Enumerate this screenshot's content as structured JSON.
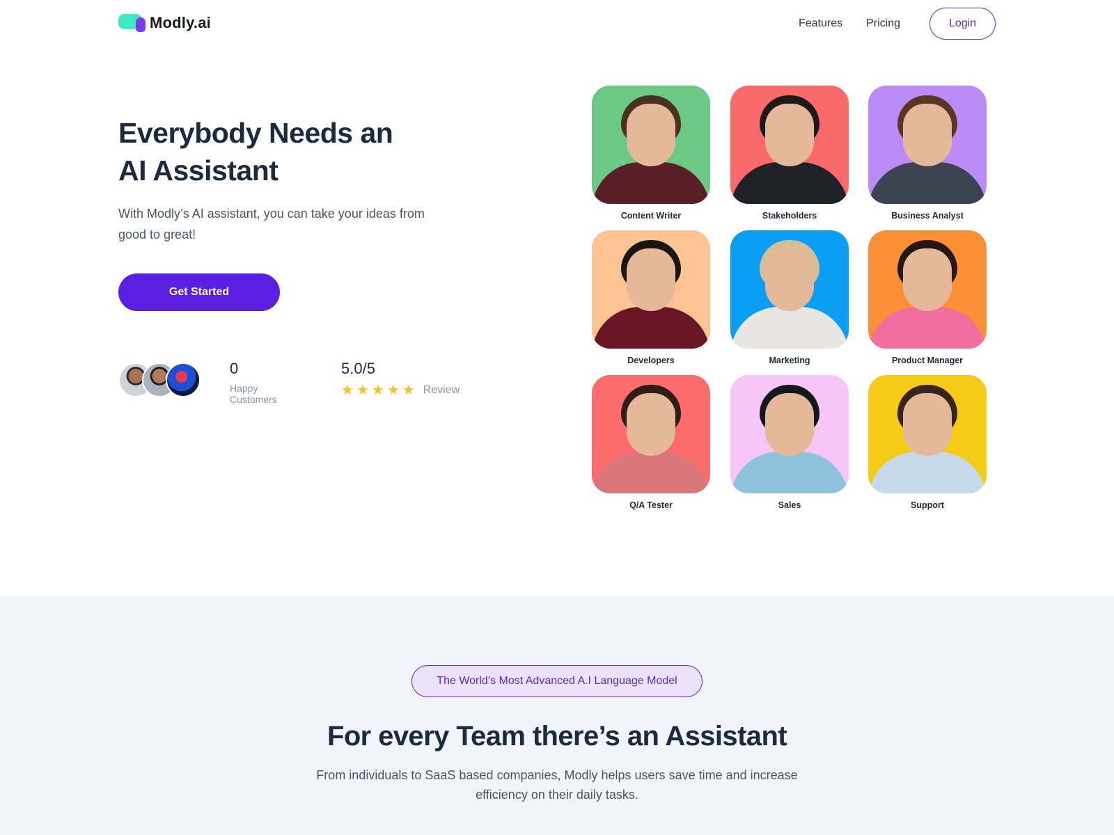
{
  "nav": {
    "logo_text": "Modly.ai",
    "links": [
      "Features",
      "Pricing"
    ],
    "login_label": "Login"
  },
  "hero": {
    "title_line1": "Everybody Needs an",
    "title_line2": "AI Assistant",
    "subtitle": "With Modly’s AI assistant, you can take your ideas from good to great!",
    "cta_label": "Get Started",
    "stats": {
      "customers_value": "0",
      "customers_label": "Happy Customers",
      "rating_value": "5.0/5",
      "rating_stars": 5,
      "rating_label": "Review"
    }
  },
  "roles": [
    {
      "label": "Content Writer",
      "bg": "#6cc985",
      "hair": "#4a3020",
      "shirt": "#5a1e26"
    },
    {
      "label": "Stakeholders",
      "bg": "#fa6a6a",
      "hair": "#1c1a1a",
      "shirt": "#1e2128"
    },
    {
      "label": "Business Analyst",
      "bg": "#bb8cf7",
      "hair": "#5a3522",
      "shirt": "#3b4350"
    },
    {
      "label": "Developers",
      "bg": "#fec393",
      "hair": "#1b1512",
      "shirt": "#6a1525"
    },
    {
      "label": "Marketing",
      "bg": "#0a9ef5",
      "hair": "#d9bd95",
      "shirt": "#e8e6e2"
    },
    {
      "label": "Product Manager",
      "bg": "#fb8f35",
      "hair": "#241714",
      "shirt": "#f06ea0"
    },
    {
      "label": "Q/A Tester",
      "bg": "#fd6c6c",
      "hair": "#2e1e17",
      "shirt": "#d9777a"
    },
    {
      "label": "Sales",
      "bg": "#f6c6f7",
      "hair": "#14181c",
      "shirt": "#8fc3dc"
    },
    {
      "label": "Support",
      "bg": "#f6cb16",
      "hair": "#3a2318",
      "shirt": "#c6d9ea"
    }
  ],
  "section2": {
    "badge": "The World’s Most Advanced A.I Language Model",
    "title": "For every Team there’s an Assistant",
    "subtitle": "From individuals to SaaS based companies, Modly helps users save time and increase efficiency on their daily tasks."
  },
  "colors": {
    "primary": "#5a1fe0",
    "accent_teal": "#3ee8c2",
    "star": "#f5c21b",
    "heading": "#1b2b3d",
    "section_bg": "#f1f4f9"
  }
}
